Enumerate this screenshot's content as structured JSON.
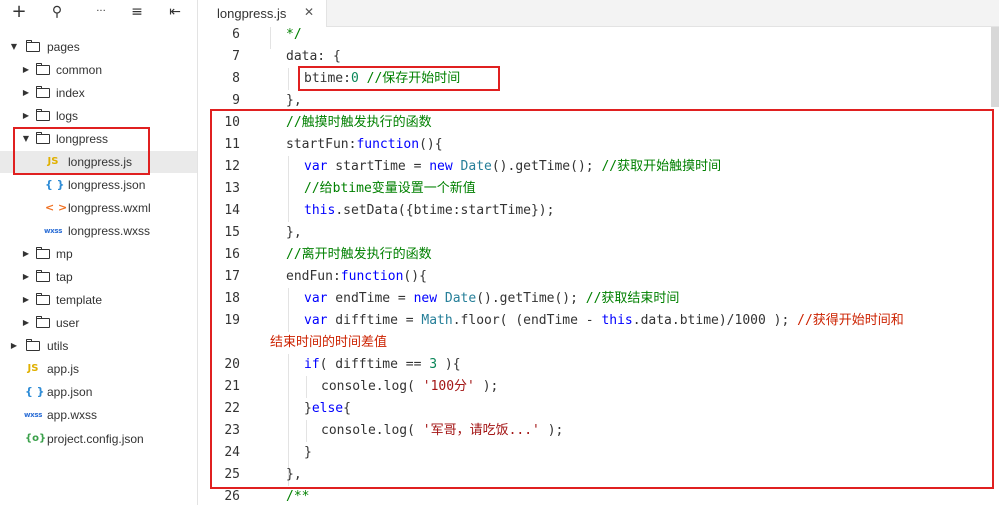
{
  "toolbar": {
    "add_icon": "+",
    "search_icon": "⚲",
    "more_icon": "···",
    "collapse_icon": "≡",
    "sidebar_icon": "⇤"
  },
  "tree": {
    "pages": "pages",
    "common": "common",
    "index": "index",
    "logs": "logs",
    "longpress": "longpress",
    "longpress_js": "longpress.js",
    "longpress_json": "longpress.json",
    "longpress_wxml": "longpress.wxml",
    "longpress_wxss": "longpress.wxss",
    "mp": "mp",
    "tap": "tap",
    "template": "template",
    "user": "user",
    "utils": "utils",
    "app_js": "app.js",
    "app_json": "app.json",
    "app_wxss": "app.wxss",
    "project_config": "project.config.json",
    "icons": {
      "js": "JS",
      "json": "{ }",
      "wxml": "< >",
      "wxss": "wxss",
      "cfg": "{o}"
    }
  },
  "tab": {
    "label": "longpress.js",
    "close": "✕"
  },
  "line_numbers": [
    "6",
    "7",
    "8",
    "9",
    "10",
    "11",
    "12",
    "13",
    "14",
    "15",
    "16",
    "17",
    "18",
    "19",
    "20",
    "21",
    "22",
    "23",
    "24",
    "25",
    "26"
  ],
  "code": {
    "l6": "*/",
    "l7": "data: {",
    "l8_a": "btime:",
    "l8_b": "0",
    "l8_c": " //保存开始时间",
    "l9": "},",
    "l10": "//触摸时触发执行的函数",
    "l11_a": "startFun:",
    "l11_b": "function",
    "l11_c": "(){",
    "l12_a": "var",
    "l12_b": " startTime = ",
    "l12_c": "new",
    "l12_d": " ",
    "l12_e": "Date",
    "l12_f": "().getTime(); ",
    "l12_g": "//获取开始触摸时间",
    "l13": "//给btime变量设置一个新值",
    "l14_a": "this",
    "l14_b": ".setData({btime:startTime});",
    "l15": "},",
    "l16": "//离开时触发执行的函数",
    "l17_a": "endFun:",
    "l17_b": "function",
    "l17_c": "(){",
    "l18_a": "var",
    "l18_b": " endTime = ",
    "l18_c": "new",
    "l18_d": " ",
    "l18_e": "Date",
    "l18_f": "().getTime(); ",
    "l18_g": "//获取结束时间",
    "l19_a": "var",
    "l19_b": " difftime = ",
    "l19_c": "Math",
    "l19_d": ".floor( (endTime - ",
    "l19_e": "this",
    "l19_f": ".data.btime)/1000 ); ",
    "l19_g": "//获得开始时间和",
    "l19_wrap": "结束时间的时间差值",
    "l20_a": "if",
    "l20_b": "( difftime == ",
    "l20_c": "3",
    "l20_d": " ){",
    "l21_a": "console.log( ",
    "l21_b": "'100分'",
    "l21_c": " );",
    "l22_a": "}",
    "l22_b": "else",
    "l22_c": "{",
    "l23_a": "console.log( ",
    "l23_b": "'军哥，请吃饭...'",
    "l23_c": " );",
    "l24": "}",
    "l25": "},",
    "l26": "/**"
  },
  "colors": {
    "highlight": "#e02020",
    "comment": "#008000",
    "keyword": "#0000ff"
  }
}
